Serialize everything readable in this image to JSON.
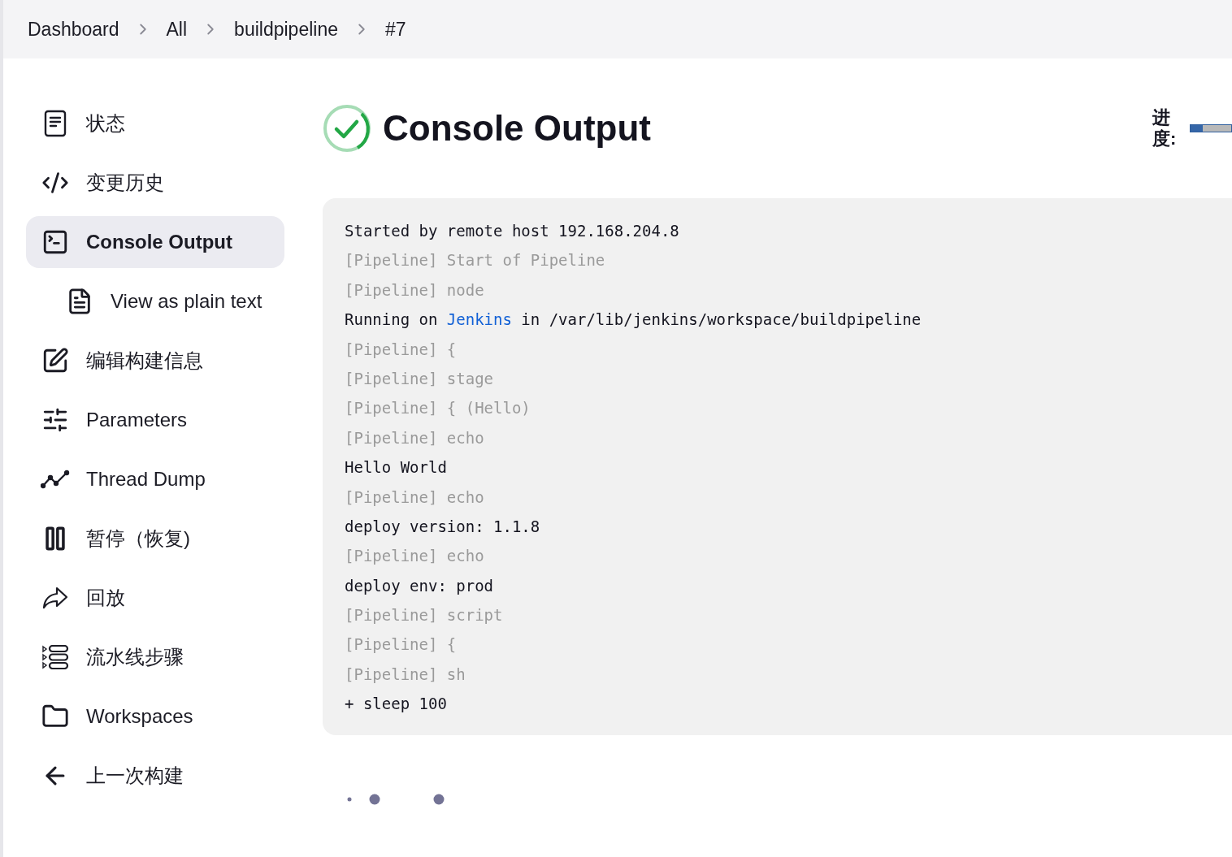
{
  "breadcrumbs": [
    "Dashboard",
    "All",
    "buildpipeline",
    "#7"
  ],
  "sidebar": {
    "items": [
      {
        "label": "状态",
        "selected": false
      },
      {
        "label": "变更历史",
        "selected": false
      },
      {
        "label": "Console Output",
        "selected": true,
        "children": [
          {
            "label": "View as plain text",
            "selected": false
          }
        ]
      },
      {
        "label": "编辑构建信息",
        "selected": false
      },
      {
        "label": "Parameters",
        "selected": false
      },
      {
        "label": "Thread Dump",
        "selected": false
      },
      {
        "label": "暂停（恢复)",
        "selected": false
      },
      {
        "label": "回放",
        "selected": false
      },
      {
        "label": "流水线步骤",
        "selected": false
      },
      {
        "label": "Workspaces",
        "selected": false
      },
      {
        "label": "上一次构建",
        "selected": false
      }
    ]
  },
  "header": {
    "title": "Console Output",
    "passed": true
  },
  "progress": {
    "label": "进度:",
    "level": 0.3
  },
  "console": {
    "lines": [
      {
        "kind": "plain",
        "text": "Started by remote host 192.168.204.8"
      },
      {
        "kind": "pipeline",
        "text": "[Pipeline] Start of Pipeline"
      },
      {
        "kind": "pipeline",
        "text": "[Pipeline] node"
      },
      {
        "kind": "link",
        "before": "Running on ",
        "link": "Jenkins",
        "after": " in /var/lib/jenkins/workspace/buildpipeline"
      },
      {
        "kind": "pipeline",
        "text": "[Pipeline] {"
      },
      {
        "kind": "pipeline",
        "text": "[Pipeline] stage"
      },
      {
        "kind": "pipeline",
        "text": "[Pipeline] { (Hello)"
      },
      {
        "kind": "pipeline",
        "text": "[Pipeline] echo"
      },
      {
        "kind": "plain",
        "text": "Hello World"
      },
      {
        "kind": "pipeline",
        "text": "[Pipeline] echo"
      },
      {
        "kind": "plain",
        "text": "deploy version: 1.1.8"
      },
      {
        "kind": "pipeline",
        "text": "[Pipeline] echo"
      },
      {
        "kind": "plain",
        "text": "deploy env: prod"
      },
      {
        "kind": "pipeline",
        "text": "[Pipeline] script"
      },
      {
        "kind": "pipeline",
        "text": "[Pipeline] {"
      },
      {
        "kind": "pipeline",
        "text": "[Pipeline] sh"
      },
      {
        "kind": "plain",
        "text": "+ sleep 100"
      }
    ]
  }
}
